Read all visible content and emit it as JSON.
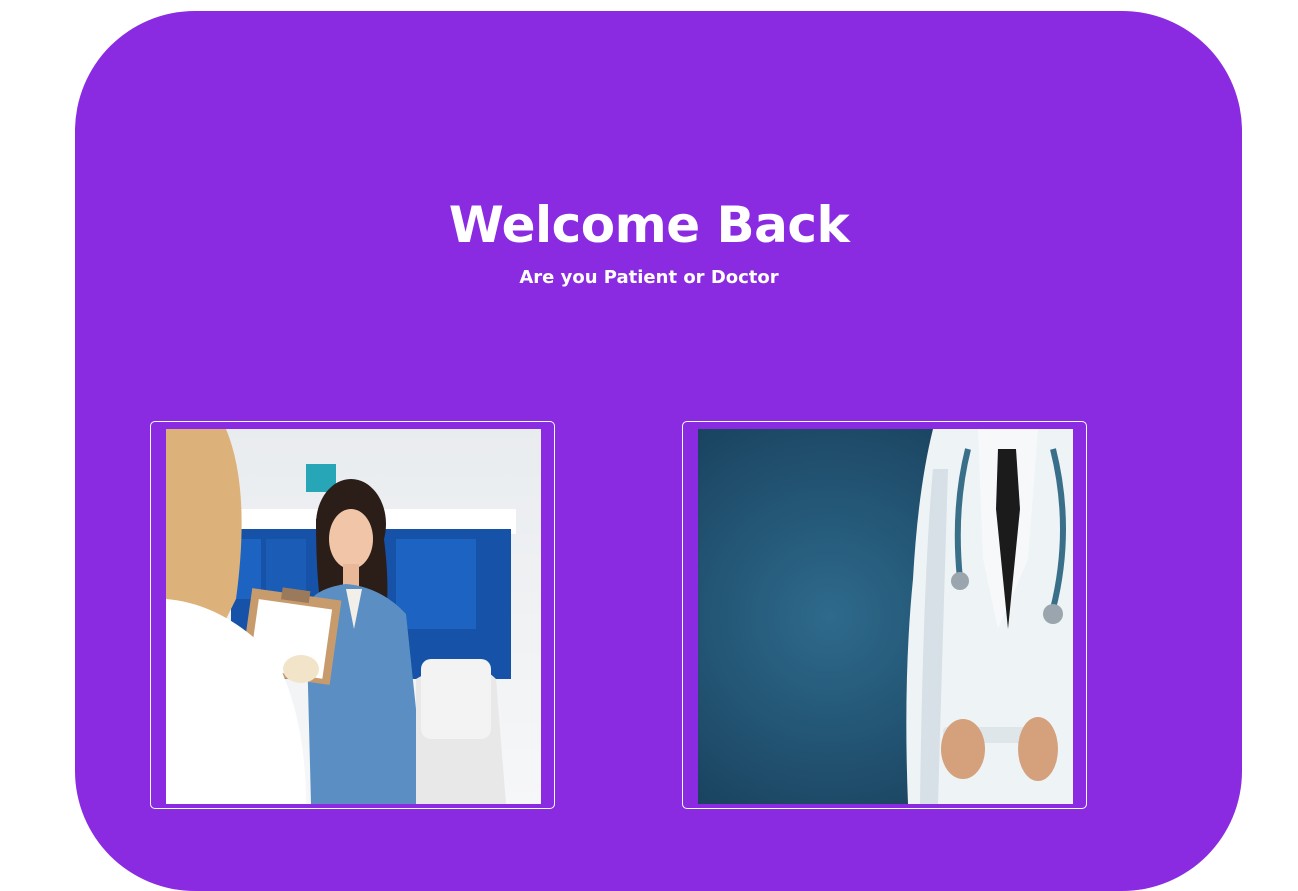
{
  "heading": {
    "title": "Welcome Back",
    "subtitle": "Are you Patient or Doctor"
  },
  "options": [
    {
      "role": "patient",
      "image_icon": "patient-photo-icon"
    },
    {
      "role": "doctor",
      "image_icon": "doctor-photo-icon"
    }
  ],
  "colors": {
    "panel_background": "#8a2be2",
    "text": "#ffffff",
    "card_border": "#ffffff"
  }
}
